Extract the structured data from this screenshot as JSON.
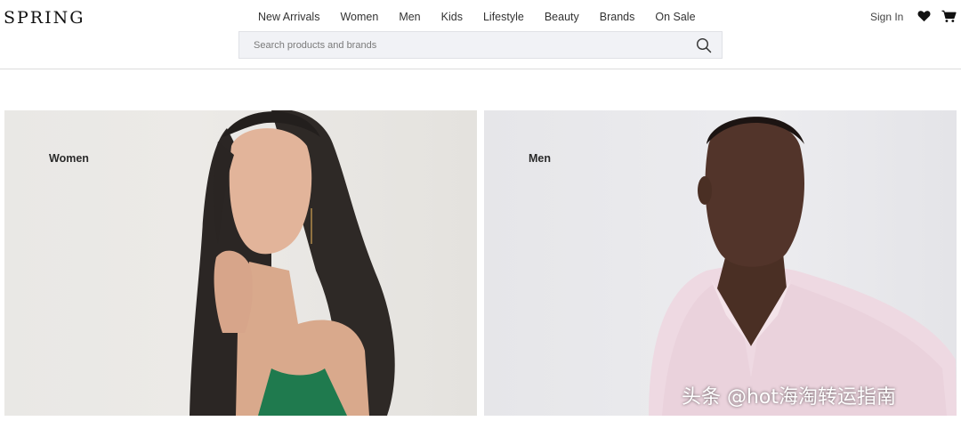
{
  "brand": {
    "logo_text": "SPRING"
  },
  "nav": {
    "items": [
      {
        "label": "New Arrivals"
      },
      {
        "label": "Women"
      },
      {
        "label": "Men"
      },
      {
        "label": "Kids"
      },
      {
        "label": "Lifestyle"
      },
      {
        "label": "Beauty"
      },
      {
        "label": "Brands"
      },
      {
        "label": "On Sale"
      }
    ]
  },
  "search": {
    "placeholder": "Search products and brands",
    "value": "",
    "icon": "search-icon"
  },
  "account": {
    "signin_label": "Sign In",
    "wishlist_icon": "heart-icon",
    "cart_icon": "cart-icon"
  },
  "tiles": [
    {
      "label": "Women"
    },
    {
      "label": "Men"
    }
  ],
  "watermark": {
    "text": "头条 @hot海淘转运指南"
  },
  "colors": {
    "accent": "#111111",
    "search_bg": "#f1f2f6",
    "divider": "#dcdcdc"
  }
}
